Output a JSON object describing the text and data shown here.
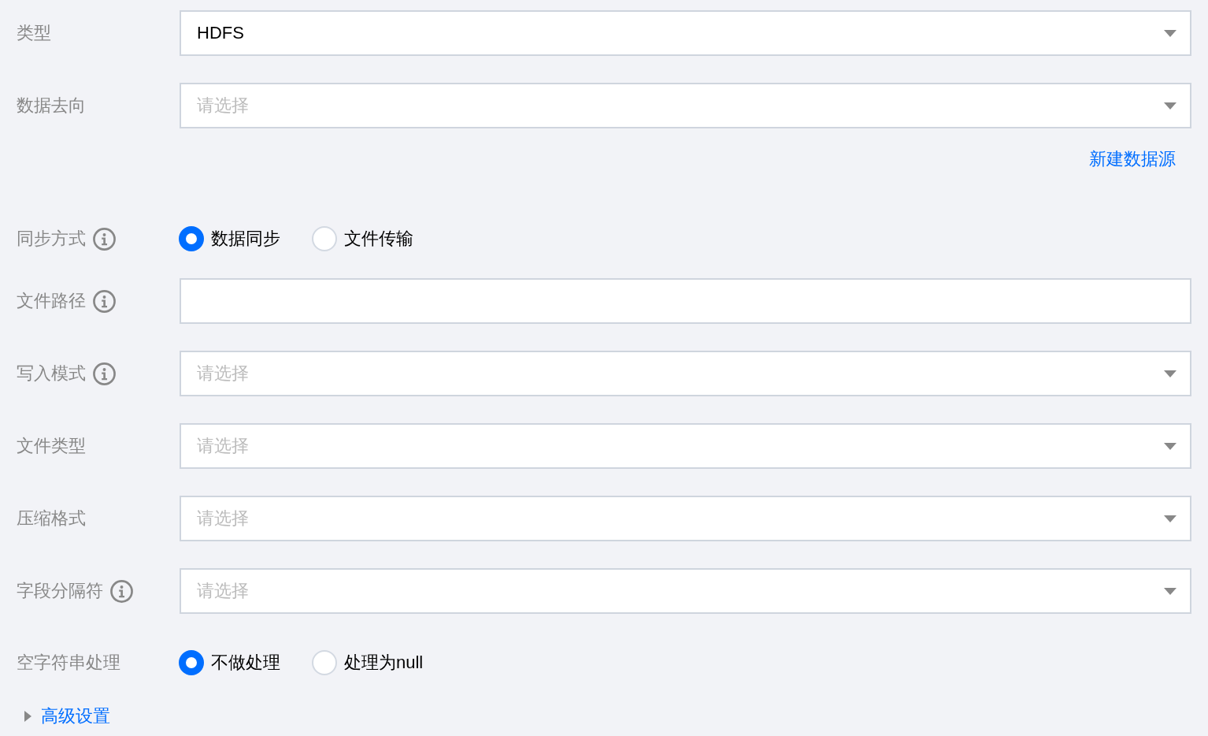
{
  "form": {
    "fields": [
      {
        "kind": "select",
        "label": "类型",
        "info": false,
        "value": "HDFS"
      },
      {
        "kind": "select",
        "label": "数据去向",
        "info": false,
        "placeholder": "请选择",
        "link": "新建数据源"
      },
      {
        "kind": "radio",
        "label": "同步方式",
        "info": true,
        "options": [
          {
            "label": "数据同步",
            "selected": true
          },
          {
            "label": "文件传输",
            "selected": false
          }
        ]
      },
      {
        "kind": "input",
        "label": "文件路径",
        "info": true
      },
      {
        "kind": "select",
        "label": "写入模式",
        "info": true,
        "placeholder": "请选择"
      },
      {
        "kind": "select",
        "label": "文件类型",
        "info": false,
        "placeholder": "请选择"
      },
      {
        "kind": "select",
        "label": "压缩格式",
        "info": false,
        "placeholder": "请选择"
      },
      {
        "kind": "select",
        "label": "字段分隔符",
        "info": true,
        "placeholder": "请选择"
      },
      {
        "kind": "radio",
        "label": "空字符串处理",
        "info": false,
        "options": [
          {
            "label": "不做处理",
            "selected": true
          },
          {
            "label": "处理为null",
            "selected": false
          }
        ]
      }
    ],
    "advanced": {
      "label": "高级设置",
      "expanded": false
    }
  }
}
